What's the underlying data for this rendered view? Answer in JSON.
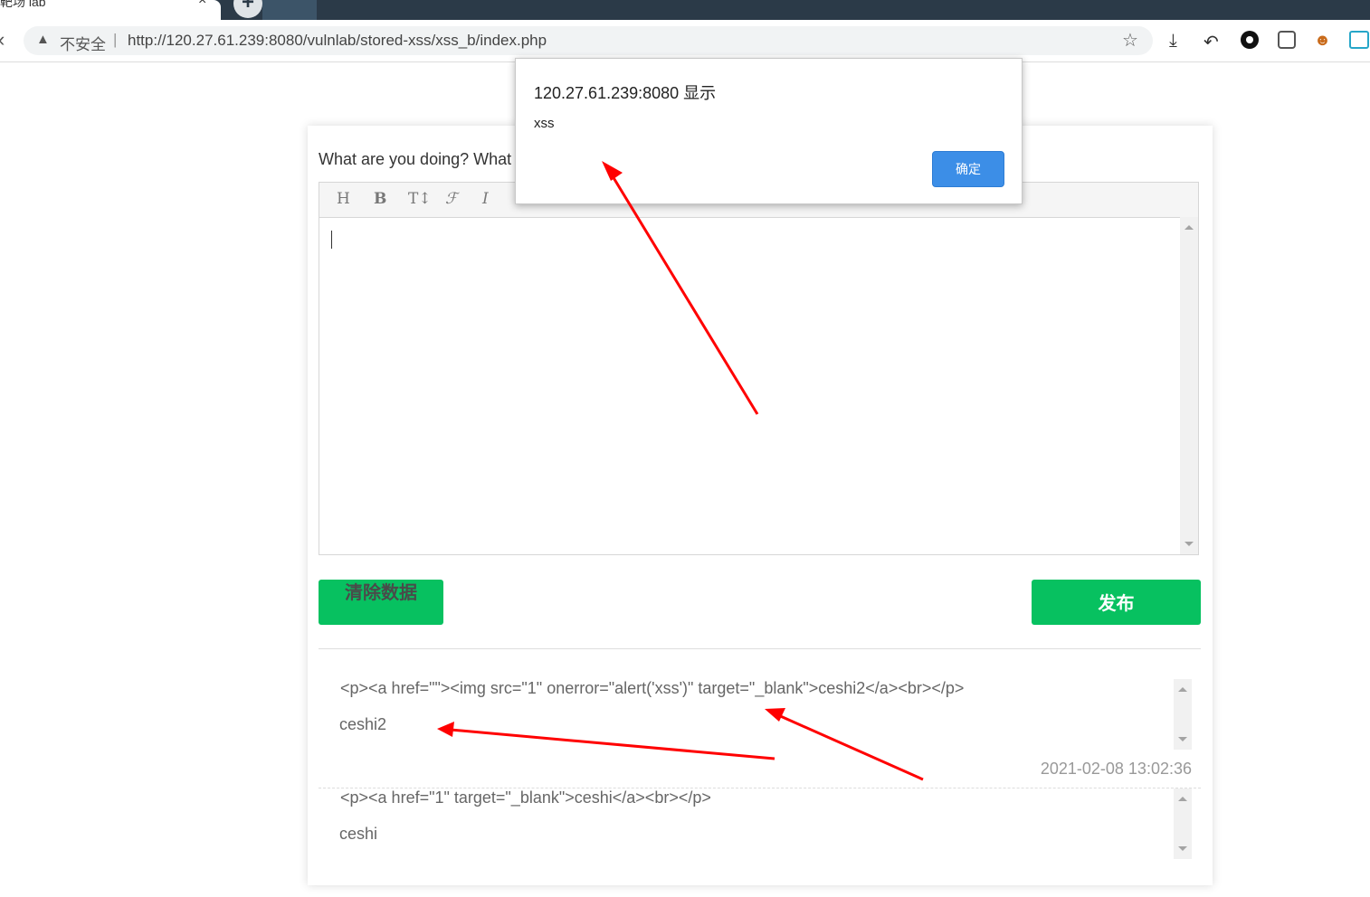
{
  "browser": {
    "tab_title": "靶场 lab",
    "tab_close": "×",
    "new_tab": "+",
    "back": "‹",
    "insecure": "不安全",
    "url_separator": "|",
    "url": "http://120.27.61.239:8080/vulnlab/stored-xss/xss_b/index.php",
    "icons": [
      "warning-icon",
      "star-icon",
      "download-icon",
      "extension-icons"
    ]
  },
  "page": {
    "prompt": "What are you doing? What",
    "editor_toolbar": {
      "heading": "H",
      "bold": "B",
      "font_size": "T↕",
      "font_family": "ℱ",
      "italic": "I"
    },
    "clear_button": "清除数据",
    "publish_button": "发布",
    "posts": [
      {
        "raw": "<p><a href=\"\"><img src=\"1\" onerror=\"alert('xss')\" target=\"_blank\">ceshi2</a><br></p>",
        "text": "ceshi2",
        "time": "2021-02-08 13:02:36"
      },
      {
        "raw": "<p><a href=\"1\" target=\"_blank\">ceshi</a><br></p>",
        "text": "ceshi",
        "time": ""
      }
    ]
  },
  "dialog": {
    "title": "120.27.61.239:8080 显示",
    "message": "xss",
    "ok_button": "确定",
    "accent": "#3c8ee7"
  },
  "annotations": {
    "arrow_color": "#ff0000"
  }
}
